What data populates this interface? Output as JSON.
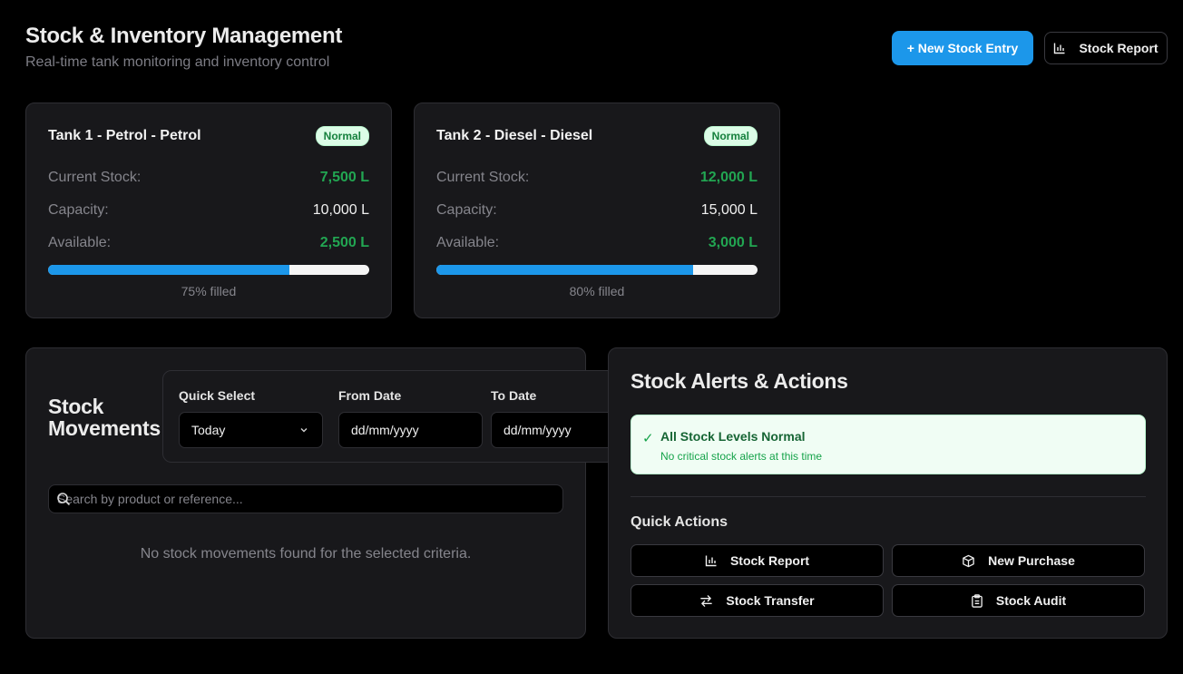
{
  "header": {
    "title": "Stock & Inventory Management",
    "subtitle": "Real-time tank monitoring and inventory control",
    "new_entry_label": "+ New Stock Entry",
    "report_label": "Stock Report"
  },
  "tanks": [
    {
      "name": "Tank 1 - Petrol - Petrol",
      "status": "Normal",
      "current_label": "Current Stock:",
      "current_value": "7,500 L",
      "capacity_label": "Capacity:",
      "capacity_value": "10,000 L",
      "available_label": "Available:",
      "available_value": "2,500 L",
      "fill_percent": 75,
      "fill_text": "75% filled"
    },
    {
      "name": "Tank 2 - Diesel - Diesel",
      "status": "Normal",
      "current_label": "Current Stock:",
      "current_value": "12,000 L",
      "capacity_label": "Capacity:",
      "capacity_value": "15,000 L",
      "available_label": "Available:",
      "available_value": "3,000 L",
      "fill_percent": 80,
      "fill_text": "80% filled"
    }
  ],
  "movements": {
    "title_line1": "Stock",
    "title_line2": "Movements",
    "quick_select_label": "Quick Select",
    "quick_select_value": "Today",
    "from_label": "From Date",
    "from_placeholder": "dd/mm/yyyy",
    "to_label": "To Date",
    "to_placeholder": "dd/mm/yyyy",
    "search_placeholder": "Search by product or reference...",
    "empty_text": "No stock movements found for the selected criteria."
  },
  "alerts": {
    "title": "Stock Alerts & Actions",
    "ok_title": "All Stock Levels Normal",
    "ok_sub": "No critical stock alerts at this time",
    "quick_actions_title": "Quick Actions",
    "actions": [
      {
        "label": "Stock Report",
        "icon": "bar-chart-icon"
      },
      {
        "label": "New Purchase",
        "icon": "package-icon"
      },
      {
        "label": "Stock Transfer",
        "icon": "transfer-arrows-icon"
      },
      {
        "label": "Stock Audit",
        "icon": "clipboard-icon"
      }
    ]
  },
  "colors": {
    "accent": "#1c97ea",
    "ok_green": "#22a652",
    "badge_bg": "#dcfce7"
  }
}
